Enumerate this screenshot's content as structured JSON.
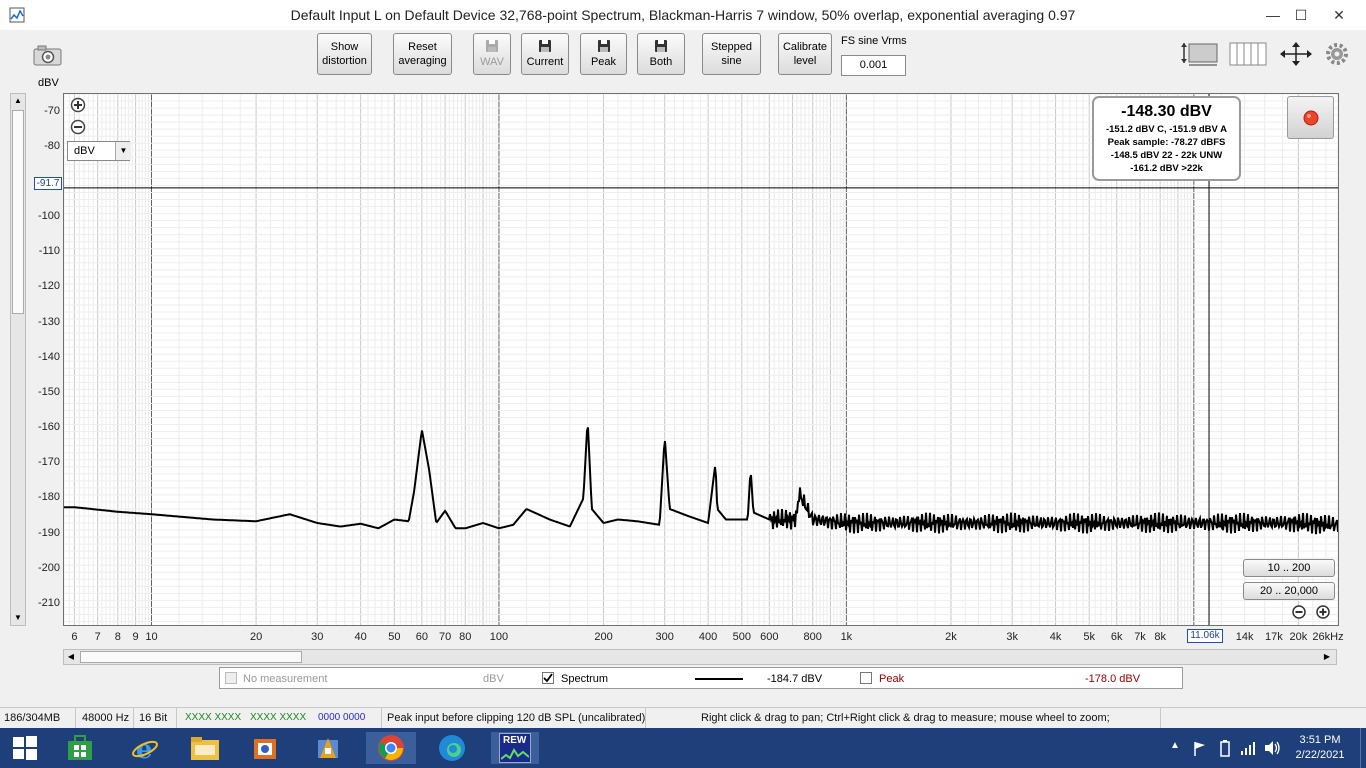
{
  "window": {
    "title": "Default Input L on Default Device 32,768-point Spectrum, Blackman-Harris 7 window, 50% overlap, exponential averaging 0.97",
    "minimize_glyph": "—",
    "maximize_glyph": "☐",
    "close_glyph": "✕"
  },
  "toolbar": {
    "show_distortion": "Show distortion",
    "reset_averaging": "Reset averaging",
    "wav": "WAV",
    "current": "Current",
    "peak": "Peak",
    "both": "Both",
    "stepped_sine": "Stepped sine",
    "calibrate_level": "Calibrate level",
    "fs_label": "FS sine Vrms",
    "fs_value": "0.001"
  },
  "plot": {
    "y_unit": "dBV",
    "y_unit_select": "dBV",
    "cursor_y_label": "-91.7",
    "cursor_x_label": "11.06k",
    "readout": {
      "main": "-148.30 dBV",
      "line1": "-151.2 dBV C, -151.9 dBV A",
      "line2": "Peak sample: -78.27 dBFS",
      "line3": "-148.5 dBV 22 - 22k UNW",
      "line4": "-161.2 dBV >22k"
    },
    "range_btn_1": "10 .. 200",
    "range_btn_2": "20 .. 20,000",
    "x_ticks": [
      "6",
      "7",
      "8",
      "9",
      "10",
      "20",
      "30",
      "40",
      "50",
      "60",
      "70",
      "80",
      "100",
      "200",
      "300",
      "400",
      "500",
      "600",
      "800",
      "1k",
      "2k",
      "3k",
      "4k",
      "5k",
      "6k",
      "7k",
      "8k",
      "14k",
      "17k",
      "20k",
      "26kHz"
    ],
    "y_ticks": [
      "-70",
      "-80",
      "-100",
      "-110",
      "-120",
      "-130",
      "-140",
      "-150",
      "-160",
      "-170",
      "-180",
      "-190",
      "-200",
      "-210"
    ]
  },
  "chart_data": {
    "type": "line",
    "xlabel": "",
    "ylabel": "dBV",
    "x_scale": "log",
    "xlim": [
      5.6,
      26000
    ],
    "ylim": [
      -216,
      -65
    ],
    "grid": true,
    "series": [
      {
        "name": "Spectrum",
        "color": "#000000",
        "x": [
          6,
          8,
          10,
          15,
          20,
          25,
          30,
          35,
          40,
          45,
          50,
          55,
          57,
          60,
          63,
          66,
          70,
          75,
          80,
          90,
          100,
          110,
          120,
          140,
          160,
          175,
          180,
          185,
          200,
          220,
          250,
          290,
          300,
          310,
          350,
          400,
          415,
          420,
          425,
          450,
          500,
          520,
          530,
          540,
          600,
          700,
          720,
          730,
          800,
          1000,
          2000,
          5000,
          10000,
          20000,
          26000
        ],
        "values": [
          -182.5,
          -183.8,
          -184.5,
          -186,
          -186.5,
          -184.5,
          -187,
          -188,
          -187.2,
          -188.5,
          -186,
          -186.5,
          -178,
          -160.5,
          -172,
          -187,
          -183.5,
          -188.5,
          -188.5,
          -187,
          -188.5,
          -187.5,
          -183,
          -186,
          -188,
          -180,
          -157.5,
          -183,
          -187,
          -186,
          -186.5,
          -187.5,
          -162.5,
          -183,
          -185,
          -187,
          -174,
          -170,
          -183,
          -186,
          -186,
          -186,
          -171.5,
          -184,
          -186,
          -186,
          -185,
          -178.5,
          -186,
          -187,
          -187,
          -187,
          -187,
          -187,
          -187.5
        ]
      }
    ]
  },
  "legend": {
    "no_measurement": "No measurement",
    "no_measurement_unit": "dBV",
    "spectrum": "Spectrum",
    "spectrum_value": "-184.7 dBV",
    "peak": "Peak",
    "peak_value": "-178.0 dBV",
    "peak_color": "#a00000"
  },
  "status": {
    "memory": "186/304MB",
    "rate": "48000 Hz",
    "bits": "16 Bit",
    "clip1": "XXXX XXXX",
    "clip2": "XXXX XXXX",
    "clip3": "0000 0000",
    "peak_input": "Peak input before clipping 120 dB SPL (uncalibrated)",
    "hint": "Right click & drag to pan; Ctrl+Right click & drag to measure; mouse wheel to zoom;"
  },
  "taskbar": {
    "time": "3:51 PM",
    "date": "2/22/2021",
    "rew_label": "REW"
  },
  "colors": {
    "accent": "#1e3f7a",
    "plot_line": "#000000",
    "cursor_box": "#1f4fbf"
  }
}
